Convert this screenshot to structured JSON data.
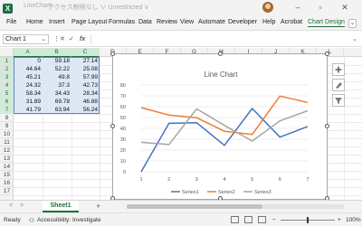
{
  "window": {
    "app_icon": "X",
    "file_name": "LineChart",
    "save_status": "アクセス制限なし ∨ Unrestricted ∨",
    "title_sep": "•"
  },
  "ribbon": {
    "tabs": [
      "File",
      "Home",
      "Insert",
      "Page Layout",
      "Formulas",
      "Data",
      "Review",
      "View",
      "Automate",
      "Developer",
      "Help",
      "Acrobat",
      "Chart Design"
    ],
    "active_tab": "Chart Design",
    "more": "⌄"
  },
  "formula_bar": {
    "name_box": "Chart 1",
    "cancel": "✕",
    "enter": "✓",
    "fx": "fx",
    "value": ""
  },
  "grid": {
    "columns": [
      "A",
      "B",
      "C",
      "D",
      "E",
      "F",
      "G",
      "H",
      "I",
      "J",
      "K",
      "L"
    ],
    "rows": [
      "1",
      "2",
      "3",
      "4",
      "5",
      "6",
      "7",
      "8",
      "9",
      "10",
      "11",
      "12",
      "13",
      "14",
      "15",
      "16",
      "17"
    ],
    "selected_columns": [
      "A",
      "B",
      "C"
    ],
    "selected_rows": [
      "1",
      "2",
      "3",
      "4",
      "5",
      "6",
      "7"
    ],
    "cells": [
      [
        "0",
        "59.18",
        "27.14"
      ],
      [
        "44.64",
        "52.22",
        "25.08"
      ],
      [
        "45.21",
        "49.8",
        "57.99"
      ],
      [
        "24.32",
        "37.3",
        "42.73"
      ],
      [
        "58.34",
        "34.43",
        "28.34"
      ],
      [
        "31.89",
        "69.78",
        "46.88"
      ],
      [
        "41.79",
        "63.94",
        "56.24"
      ]
    ]
  },
  "chart_data": {
    "type": "line",
    "title": "Line Chart",
    "x": [
      1,
      2,
      3,
      4,
      5,
      6,
      7
    ],
    "series": [
      {
        "name": "Series1",
        "color": "#4472c4",
        "values": [
          0,
          44.64,
          45.21,
          24.32,
          58.34,
          31.89,
          41.79
        ]
      },
      {
        "name": "Series2",
        "color": "#ed7d31",
        "values": [
          59.18,
          52.22,
          49.8,
          37.3,
          34.43,
          69.78,
          63.94
        ]
      },
      {
        "name": "Series3",
        "color": "#a5a5a5",
        "values": [
          27.14,
          25.08,
          57.99,
          42.73,
          28.34,
          46.88,
          56.24
        ]
      }
    ],
    "ylim": [
      0,
      80
    ],
    "yticks": [
      0,
      10,
      20,
      30,
      40,
      50,
      60,
      70,
      80
    ],
    "grid": true,
    "legend": "bottom"
  },
  "sheets": {
    "tabs": [
      "Sheet1"
    ],
    "active": "Sheet1",
    "prev": "<",
    "next": ">",
    "add": "+"
  },
  "status": {
    "ready": "Ready",
    "accessibility": "Accessibility: Investigate",
    "zoom": "100%",
    "zoom_out": "−",
    "zoom_in": "+"
  }
}
